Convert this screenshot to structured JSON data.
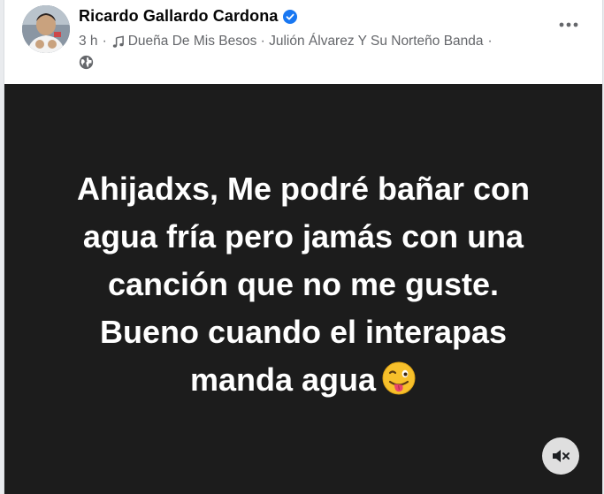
{
  "post": {
    "author": "Ricardo Gallardo Cardona",
    "verified_icon": "verified-badge-icon",
    "time": "3 h",
    "meta_sep": "·",
    "song": "Dueña De Mis Besos · Julión Álvarez Y Su Norteño Banda",
    "meta_trailing_sep": "·",
    "privacy_icon": "globe-icon",
    "more_icon": "more-options-icon"
  },
  "media": {
    "caption_lines": [
      "Ahijadxs, Me podré bañar con",
      "agua fría pero jamás con una",
      "canción que no me guste.",
      "Bueno cuando el interapas",
      "manda agua"
    ],
    "emoji": "winking-face-with-tongue",
    "mute_icon": "speaker-muted-icon"
  },
  "colors": {
    "verified": "#1877f2",
    "meta_text": "#65676b",
    "media_bg": "#1c1c1c"
  }
}
